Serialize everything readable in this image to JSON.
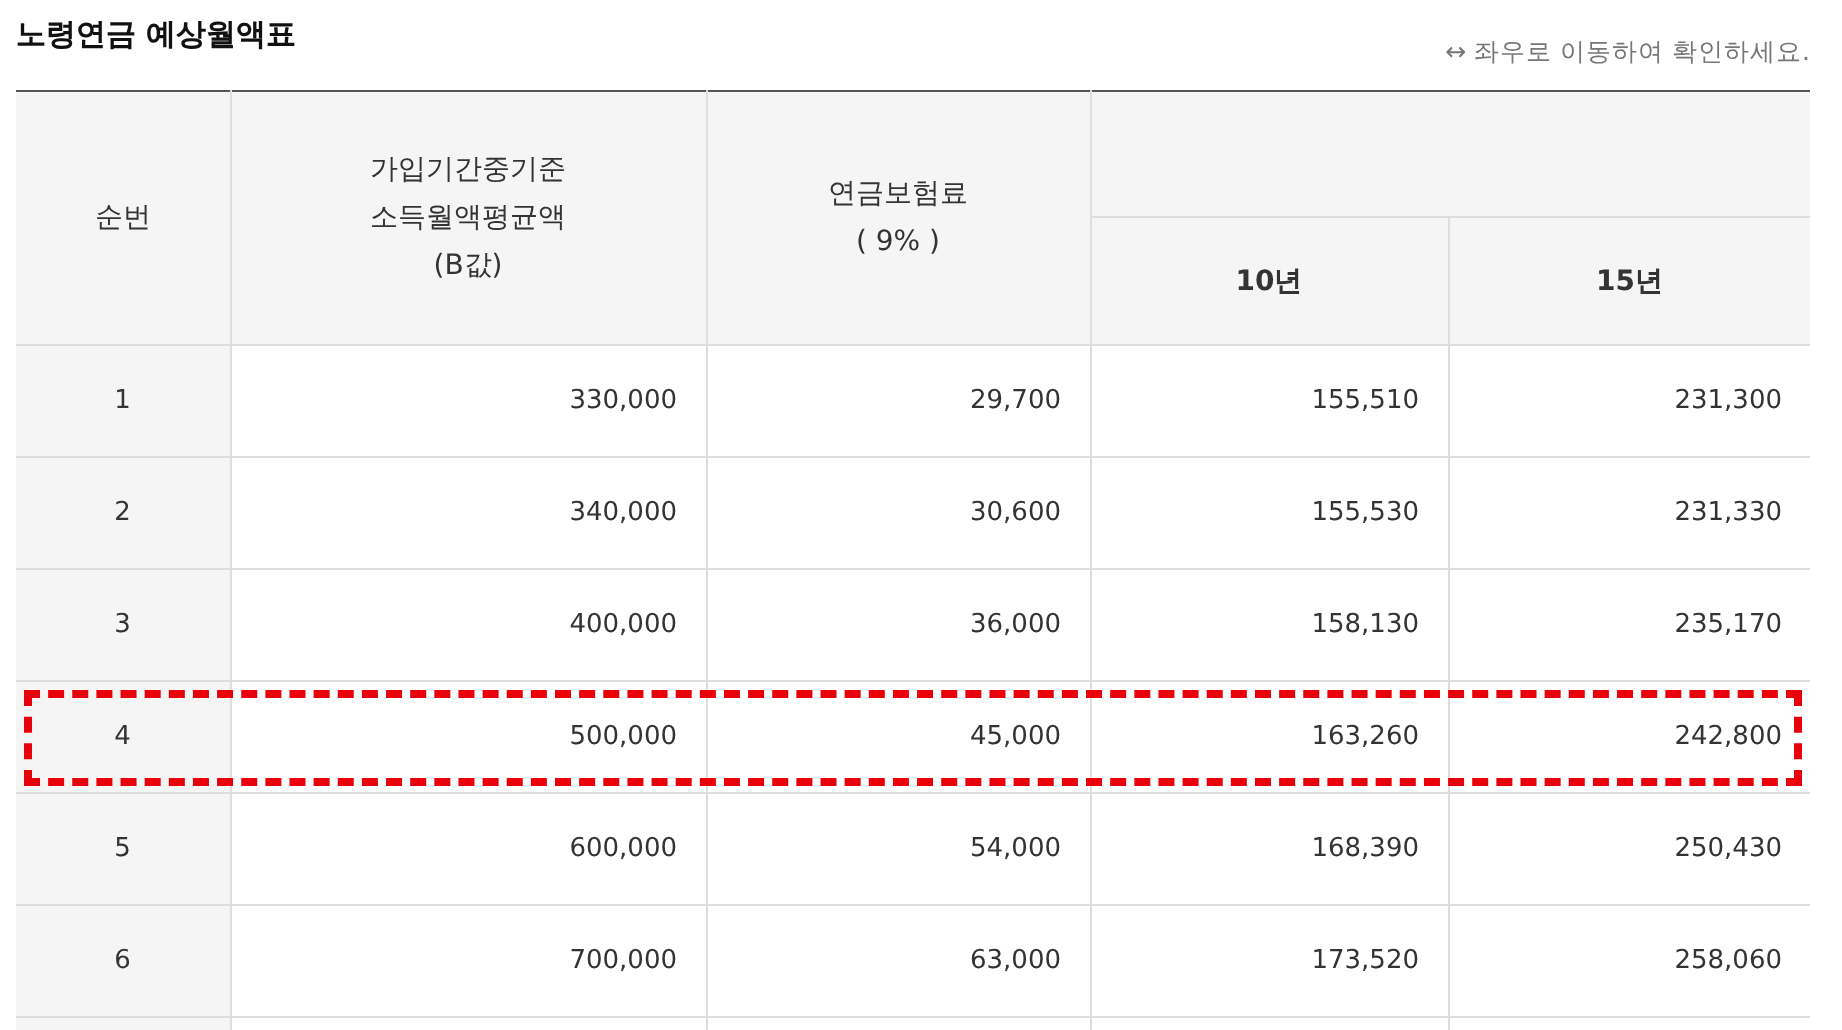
{
  "title": "노령연금 예상월액표",
  "hint": "↔ 좌우로 이동하여 확인하세요.",
  "columns": [
    "순번",
    [
      "가입기간중기준",
      "소득월액평균액",
      "(B값)"
    ],
    [
      "연금보험료",
      "( 9% )"
    ]
  ],
  "sub_columns": [
    "10년",
    "15년"
  ],
  "rows": [
    {
      "cells": [
        "1",
        "330,000",
        "29,700",
        "155,510",
        "231,300"
      ],
      "highlighted": false
    },
    {
      "cells": [
        "2",
        "340,000",
        "30,600",
        "155,530",
        "231,330"
      ],
      "highlighted": false
    },
    {
      "cells": [
        "3",
        "400,000",
        "36,000",
        "158,130",
        "235,170"
      ],
      "highlighted": false
    },
    {
      "cells": [
        "4",
        "500,000",
        "45,000",
        "163,260",
        "242,800"
      ],
      "highlighted": true
    },
    {
      "cells": [
        "5",
        "600,000",
        "54,000",
        "168,390",
        "250,430"
      ],
      "highlighted": false
    },
    {
      "cells": [
        "6",
        "700,000",
        "63,000",
        "173,520",
        "258,060"
      ],
      "highlighted": false
    }
  ]
}
